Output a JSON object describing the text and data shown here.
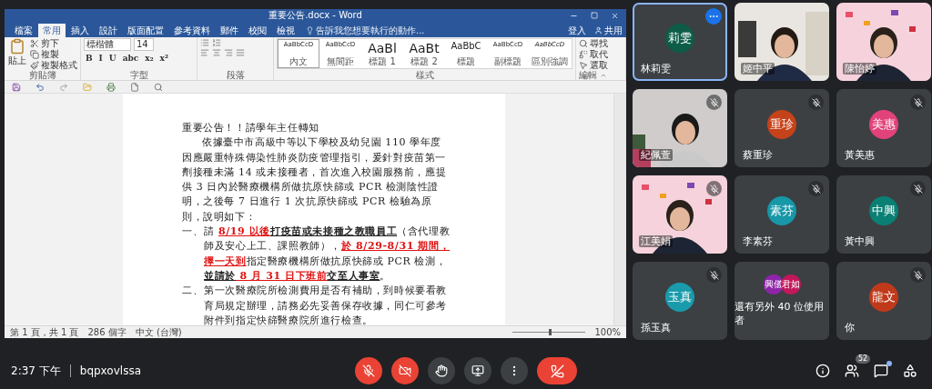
{
  "word": {
    "title": "重要公告.docx - Word",
    "tabs": [
      {
        "label": "檔案",
        "selected": false
      },
      {
        "label": "常用",
        "selected": true
      },
      {
        "label": "插入",
        "selected": false
      },
      {
        "label": "設計",
        "selected": false
      },
      {
        "label": "版面配置",
        "selected": false
      },
      {
        "label": "參考資料",
        "selected": false
      },
      {
        "label": "郵件",
        "selected": false
      },
      {
        "label": "校閱",
        "selected": false
      },
      {
        "label": "檢視",
        "selected": false
      }
    ],
    "tell_me": "告訴我您想要執行的動作...",
    "sign_in": "登入",
    "share": "共用",
    "clipboard": {
      "paste": "貼上",
      "cut": "剪下",
      "copy": "複製",
      "format_painter": "複製格式",
      "label": "剪貼簿"
    },
    "font": {
      "name": "標楷體",
      "size": "14",
      "format_buttons": [
        "B",
        "I",
        "U",
        "abc",
        "x₂",
        "x²"
      ],
      "label": "字型"
    },
    "paragraph": {
      "label": "段落"
    },
    "styles": {
      "label": "樣式",
      "items": [
        {
          "sample": "AaBbCcD",
          "name": "內文",
          "kind": "small",
          "selected": true
        },
        {
          "sample": "AaBbCcD",
          "name": "無間距",
          "kind": "small",
          "selected": false
        },
        {
          "sample": "AaBl",
          "name": "標題 1",
          "kind": "large",
          "selected": false
        },
        {
          "sample": "AaBt",
          "name": "標題 2",
          "kind": "large",
          "selected": false
        },
        {
          "sample": "AaBbC",
          "name": "標題",
          "kind": "medium",
          "selected": false
        },
        {
          "sample": "AaBbCcD",
          "name": "副標題",
          "kind": "small",
          "selected": false
        },
        {
          "sample": "AaBbCcD",
          "name": "區別強調",
          "kind": "italic",
          "selected": false
        }
      ]
    },
    "editing": {
      "find": "尋找",
      "replace": "取代",
      "select": "選取",
      "label": "編輯"
    },
    "document": {
      "paragraphs": [
        {
          "kind": "heading",
          "runs": [
            {
              "text": "重要公告！！請學年主任轉知",
              "kind": "plain"
            }
          ]
        },
        {
          "kind": "body",
          "runs": [
            {
              "text": "依據臺中市高級中等以下學校及幼兒園 110 學年度因應嚴重特殊傳染性肺炎防疫管理指引，爰針對疫苗第一劑接種未滿 14 或未接種者，首次進入校園服務前，應提供 3 日內於醫療機構所做抗原快篩或 PCR 檢測陰性證明，之後每 7 日進行 1 次抗原快篩或 PCR 檢驗為原則，說明如下：",
              "kind": "plain"
            }
          ]
        },
        {
          "kind": "item",
          "marker": "一、",
          "runs": [
            {
              "text": "請 ",
              "kind": "plain"
            },
            {
              "text": "8/19 以後",
              "kind": "red"
            },
            {
              "text": "打疫苗或未接種之教職員工",
              "kind": "bold"
            },
            {
              "text": "（含代理教師及安心上工、課照教師），",
              "kind": "plain"
            },
            {
              "text": "於 8/29-8/31 期間，擇一天到",
              "kind": "red"
            },
            {
              "text": "指定醫療機構所做抗原快篩或 PCR 檢測，",
              "kind": "plain"
            },
            {
              "text": "並請於",
              "kind": "bold"
            },
            {
              "text": " 8 月 31 日下班前",
              "kind": "red"
            },
            {
              "text": "交至人事室",
              "kind": "bold"
            },
            {
              "text": "。",
              "kind": "plain"
            }
          ]
        },
        {
          "kind": "item",
          "marker": "二、",
          "runs": [
            {
              "text": "第一次醫療院所檢測費用是否有補助，到時候要看教育局規定辦理，請務必先妥善保存收據，同仁可參考附件到指定快篩醫療院所進行檢查。",
              "kind": "plain"
            }
          ]
        }
      ]
    },
    "status": {
      "page": "第 1 頁，共 1 頁",
      "words": "286 個字",
      "language": "中文 (台灣)",
      "zoom": "100%",
      "zoom_slider": {
        "level": 0.5
      }
    }
  },
  "meeting": {
    "tiles": [
      {
        "kind": "avatar",
        "name": "林莉雯",
        "initials": "莉雯",
        "color": "#0d5c47",
        "muted": false,
        "highlighted": true
      },
      {
        "kind": "picture",
        "name": "姬中平",
        "muted": false,
        "highlighted": false
      },
      {
        "kind": "picture",
        "name": "陳怡婷",
        "muted": false,
        "highlighted": false
      },
      {
        "kind": "picture",
        "name": "紀佩萱",
        "muted": true,
        "highlighted": false
      },
      {
        "kind": "avatar",
        "name": "蔡重珍",
        "initials": "重珍",
        "color": "#c5421a",
        "muted": true,
        "highlighted": false
      },
      {
        "kind": "avatar",
        "name": "黃美惠",
        "initials": "美惠",
        "color": "#e2427a",
        "muted": true,
        "highlighted": false
      },
      {
        "kind": "picture",
        "name": "江美娟",
        "muted": true,
        "highlighted": false
      },
      {
        "kind": "avatar",
        "name": "李素芬",
        "initials": "素芬",
        "color": "#1797a8",
        "muted": true,
        "highlighted": false
      },
      {
        "kind": "avatar",
        "name": "黃中興",
        "initials": "中興",
        "color": "#0a8074",
        "muted": true,
        "highlighted": false
      },
      {
        "kind": "avatar",
        "name": "孫玉真",
        "initials": "玉真",
        "color": "#1a9bab",
        "muted": true,
        "highlighted": false
      },
      {
        "kind": "group",
        "name": "還有另外 40 位使用者",
        "avatars": [
          {
            "initials": "興儀",
            "color": "#8e24aa"
          },
          {
            "initials": "君如",
            "color": "#c2185b"
          }
        ],
        "muted": false,
        "highlighted": false
      },
      {
        "kind": "avatar",
        "name": "你",
        "initials": "龍文",
        "color": "#c1391b",
        "muted": true,
        "highlighted": false
      }
    ],
    "time": "2:37 下午",
    "meeting_code": "bqpxovlssa",
    "controls": {
      "mic_on": false,
      "camera_on": false
    },
    "people_count": "52",
    "chat_unread": true
  }
}
